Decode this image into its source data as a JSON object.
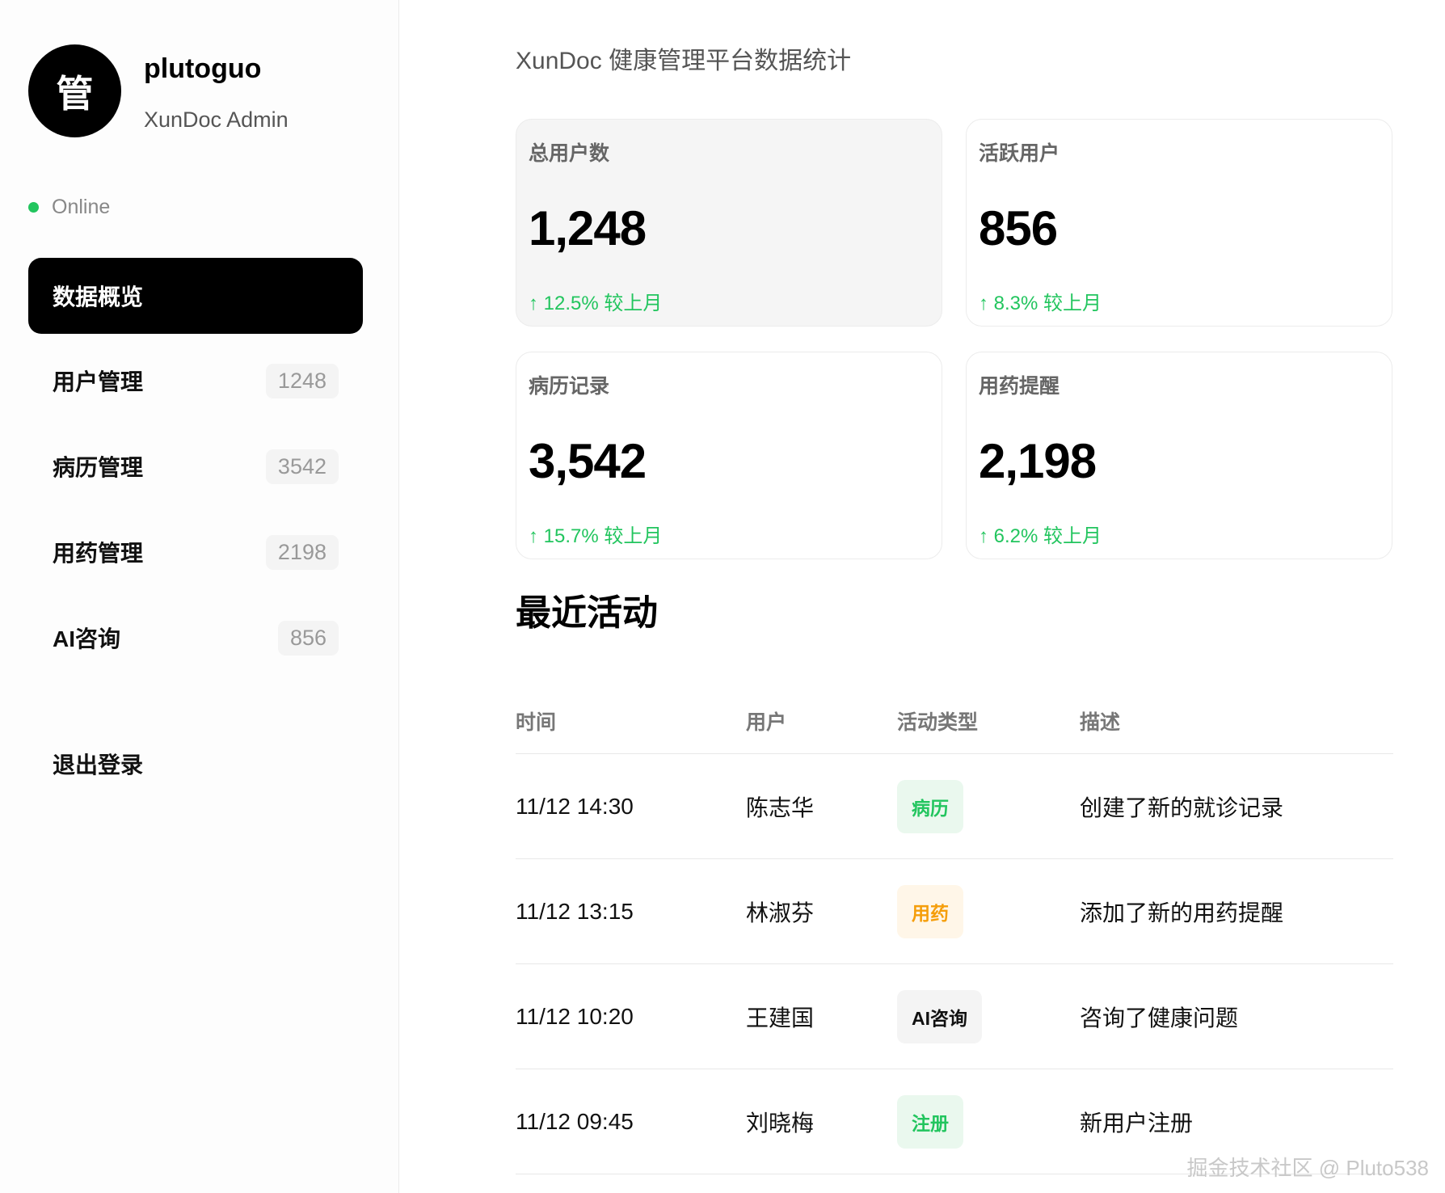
{
  "sidebar": {
    "avatar_char": "管",
    "username": "plutoguo",
    "role": "XunDoc Admin",
    "status": "Online",
    "nav": [
      {
        "label": "数据概览",
        "badge": ""
      },
      {
        "label": "用户管理",
        "badge": "1248"
      },
      {
        "label": "病历管理",
        "badge": "3542"
      },
      {
        "label": "用药管理",
        "badge": "2198"
      },
      {
        "label": "AI咨询",
        "badge": "856"
      }
    ],
    "logout": "退出登录"
  },
  "main": {
    "title": "XunDoc 健康管理平台数据统计",
    "cards": [
      {
        "label": "总用户数",
        "value": "1,248",
        "change": "↑ 12.5% 较上月"
      },
      {
        "label": "活跃用户",
        "value": "856",
        "change": "↑ 8.3% 较上月"
      },
      {
        "label": "病历记录",
        "value": "3,542",
        "change": "↑ 15.7% 较上月"
      },
      {
        "label": "用药提醒",
        "value": "2,198",
        "change": "↑ 6.2% 较上月"
      }
    ],
    "activity_title": "最近活动",
    "table": {
      "headers": [
        "时间",
        "用户",
        "活动类型",
        "描述"
      ],
      "rows": [
        {
          "time": "11/12 14:30",
          "user": "陈志华",
          "type": "病历",
          "desc": "创建了新的就诊记录"
        },
        {
          "time": "11/12 13:15",
          "user": "林淑芬",
          "type": "用药",
          "desc": "添加了新的用药提醒"
        },
        {
          "time": "11/12 10:20",
          "user": "王建国",
          "type": "AI咨询",
          "desc": "咨询了健康问题"
        },
        {
          "time": "11/12 09:45",
          "user": "刘晓梅",
          "type": "注册",
          "desc": "新用户注册"
        }
      ]
    }
  },
  "tag_colors": {
    "病历": {
      "bg": "#eaf8ee",
      "fg": "#22c55e"
    },
    "用药": {
      "bg": "#fff6e8",
      "fg": "#f59e0b"
    },
    "AI咨询": {
      "bg": "#f4f4f4",
      "fg": "#111111"
    },
    "注册": {
      "bg": "#eaf8ee",
      "fg": "#22c55e"
    }
  },
  "watermark": "掘金技术社区 @ Pluto538"
}
